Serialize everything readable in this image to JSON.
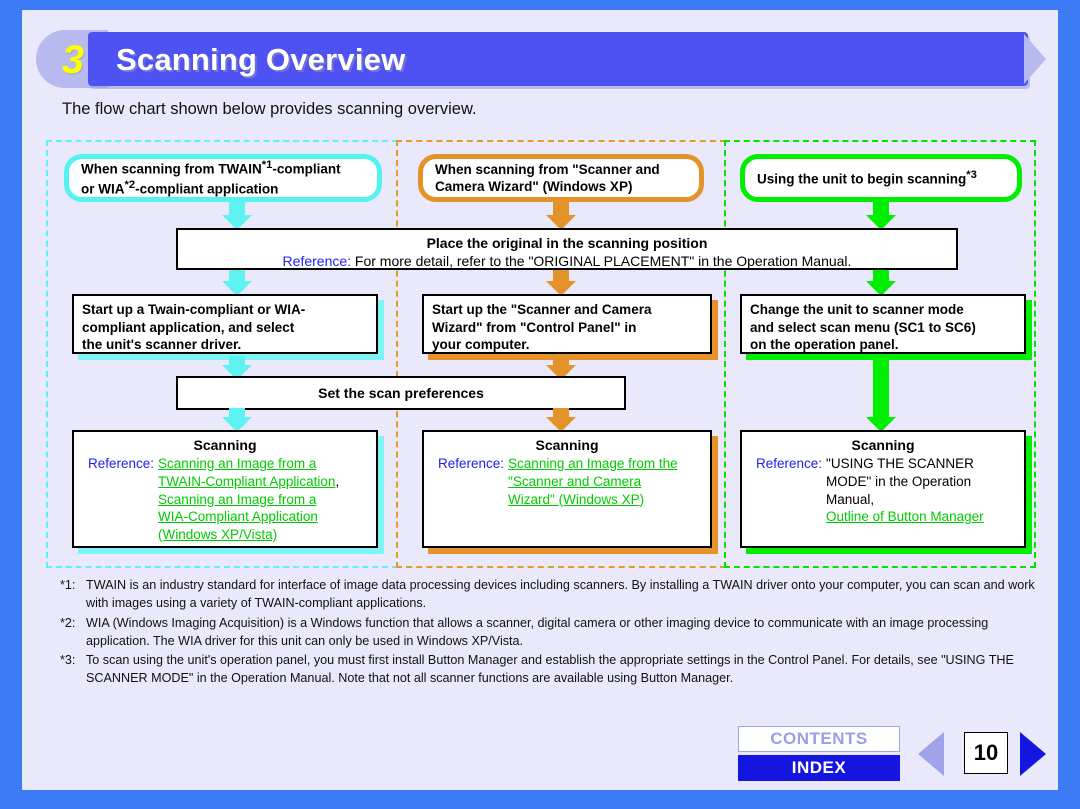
{
  "header": {
    "chapter_number": "3",
    "title": "Scanning Overview",
    "intro": "The flow chart shown below provides scanning overview."
  },
  "flow": {
    "columns": [
      {
        "accent": "#55f2f2",
        "entry": "When scanning from TWAIN*1-compliant or WIA*2-compliant application",
        "step": "Start up a Twain-compliant or WIA-compliant application, and select the unit's scanner driver.",
        "scan_title": "Scanning",
        "reference_label": "Reference:",
        "reference_body": "Scanning an Image from a TWAIN-Compliant Application, Scanning an Image from a WIA-Compliant Application (Windows XP/Vista)"
      },
      {
        "accent": "#e3932a",
        "entry": "When scanning from \"Scanner and Camera Wizard\" (Windows XP)",
        "step": "Start up the \"Scanner and Camera Wizard\" from \"Control Panel\" in your computer.",
        "scan_title": "Scanning",
        "reference_label": "Reference:",
        "reference_body": "Scanning an Image from the \"Scanner and Camera Wizard\" (Windows XP)"
      },
      {
        "accent": "#00ef00",
        "entry": "Using the unit to begin scanning*3",
        "step": "Change the unit to scanner mode and select scan menu (SC1 to SC6) on the operation panel.",
        "scan_title": "Scanning",
        "reference_label": "Reference:",
        "reference_body": "\"USING THE SCANNER MODE\" in the Operation Manual, Outline of Button Manager"
      }
    ],
    "place_original": {
      "title": "Place the original in the scanning position",
      "reference_label": "Reference:",
      "reference_text": "For more detail, refer to the \"ORIGINAL PLACEMENT\" in the Operation Manual."
    },
    "set_preferences": "Set the scan preferences",
    "links": {
      "c1_l1": "Scanning an Image from a ",
      "c1_l2": "TWAIN-Compliant Application",
      "c1_comma": ",",
      "c1_l3": "Scanning an Image from a ",
      "c1_l4": "WIA-Compliant Application ",
      "c1_l5": "(Windows XP/Vista)",
      "c2_l1": "Scanning an Image from the ",
      "c2_l2": "\"Scanner and Camera ",
      "c2_l3": "Wizard\" (Windows XP)",
      "c3_t1": "\"USING THE SCANNER",
      "c3_t2": "MODE\" in the Operation",
      "c3_t3": "Manual,",
      "c3_l1": "Outline of Button Manager"
    }
  },
  "footnotes": [
    {
      "label": "*1:",
      "text": "TWAIN is an industry standard for interface of image data processing devices including scanners. By installing a TWAIN driver onto your computer, you can scan and work with images using a variety of TWAIN-compliant applications."
    },
    {
      "label": "*2:",
      "text": "WIA (Windows Imaging Acquisition) is a Windows function that allows a scanner, digital camera or other imaging device to communicate with an image processing application. The WIA driver for this unit can only be used in Windows XP/Vista."
    },
    {
      "label": "*3:",
      "text": "To scan using the unit's operation panel, you must first install Button Manager and establish the appropriate settings in the Control Panel. For details, see \"USING THE SCANNER MODE\" in the Operation Manual. Note that not all scanner functions are available using Button Manager."
    }
  ],
  "footer": {
    "contents_label": "CONTENTS",
    "index_label": "INDEX",
    "page_number": "10",
    "prev_icon": "left-triangle-icon",
    "next_icon": "right-triangle-icon"
  }
}
